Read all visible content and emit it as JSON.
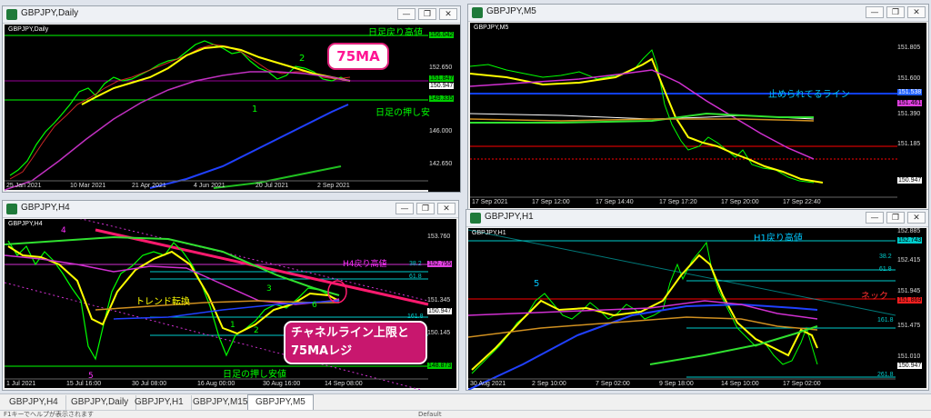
{
  "windows": {
    "daily": {
      "title": "GBPJPY,Daily",
      "symbol_label": "GBPJPY,Daily",
      "prices": [
        "156.042",
        "152.650",
        "151.847",
        "150.947",
        "149.335",
        "146.000",
        "142.650"
      ],
      "dates": [
        "25 Jan 2021",
        "10 Mar 2021",
        "21 Apr 2021",
        "4 Jun 2021",
        "20 Jul 2021",
        "2 Sep 2021"
      ],
      "annotations": {
        "rebound_high": "日足戻り高値",
        "pullback_low": "日足の押し安",
        "wave1": "1",
        "wave2": "2"
      }
    },
    "m5": {
      "title": "GBPJPY,M5",
      "symbol_label": "GBPJPY,M5",
      "prices": [
        "151.805",
        "151.600",
        "151.538",
        "151.461",
        "151.390",
        "151.185",
        "150.947"
      ],
      "dates": [
        "17 Sep 2021",
        "17 Sep 12:00",
        "17 Sep 14:40",
        "17 Sep 17:20",
        "17 Sep 20:00",
        "17 Sep 22:40"
      ],
      "annotations": {
        "stopped_line": "止められてるライン"
      }
    },
    "h4": {
      "title": "GBPJPY,H4",
      "symbol_label": "GBPJPY,H4",
      "prices": [
        "153.760",
        "152.755",
        "38.2",
        "61.8",
        "151.345",
        "150.947",
        "161.8",
        "150.145",
        "148.873"
      ],
      "dates": [
        "1 Jul 2021",
        "15 Jul 16:00",
        "30 Jul 08:00",
        "16 Aug 00:00",
        "30 Aug 16:00",
        "14 Sep 08:00"
      ],
      "annotations": {
        "h4_rebound_high": "H4戻り高値",
        "trend_change": "トレンド転換",
        "daily_pullback": "日足の押し安値",
        "w1": "1",
        "w2": "2",
        "w3": "3",
        "w4": "4",
        "w5": "5",
        "w6": "6"
      }
    },
    "h1": {
      "title": "GBPJPY,H1",
      "symbol_label": "GBPJPY,H1",
      "prices": [
        "152.885",
        "152.743",
        "38.2",
        "152.415",
        "61.8",
        "151.945",
        "151.869",
        "161.8",
        "151.475",
        "151.010",
        "150.947",
        "261.8"
      ],
      "dates": [
        "30 Aug 2021",
        "2 Sep 10:00",
        "7 Sep 02:00",
        "9 Sep 18:00",
        "14 Sep 10:00",
        "17 Sep 02:00"
      ],
      "annotations": {
        "h1_rebound_high": "H1戻り高値",
        "neck": "ネック",
        "w5": "5"
      }
    }
  },
  "callouts": {
    "ma75": "75MA",
    "channel_line1": "チャネルライン上限と",
    "channel_line2": "75MAレジ"
  },
  "window_buttons": {
    "min": "—",
    "restore": "❐",
    "close": "✕"
  },
  "tabs": [
    "GBPJPY,H4",
    "GBPJPY,Daily",
    "GBPJPY,H1",
    "GBPJPY,M15",
    "GBPJPY,M5"
  ],
  "status": {
    "left": "F1キーでヘルプが表示されます",
    "mid": "Default"
  },
  "colors": {
    "price_candles": "#00ff00",
    "ma_yellow": "#ffff00",
    "ma_magenta": "#ff00ff",
    "ma_blue": "#0000ff",
    "trend_pink": "#ff1a6e",
    "fibo": "#00cccc"
  }
}
